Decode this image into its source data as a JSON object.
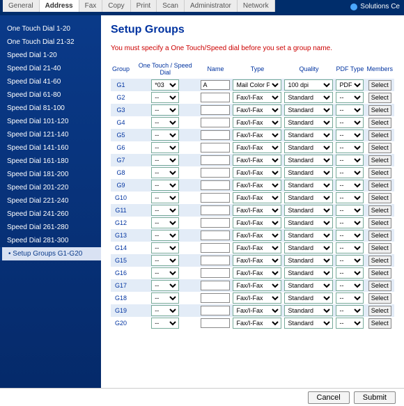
{
  "tabs": [
    "General",
    "Address",
    "Fax",
    "Copy",
    "Print",
    "Scan",
    "Administrator",
    "Network"
  ],
  "active_tab": 1,
  "brand": "Solutions Ce",
  "sidebar": {
    "items": [
      "One Touch Dial 1-20",
      "One Touch Dial 21-32",
      "Speed Dial 1-20",
      "Speed Dial 21-40",
      "Speed Dial 41-60",
      "Speed Dial 61-80",
      "Speed Dial 81-100",
      "Speed Dial 101-120",
      "Speed Dial 121-140",
      "Speed Dial 141-160",
      "Speed Dial 161-180",
      "Speed Dial 181-200",
      "Speed Dial 201-220",
      "Speed Dial 221-240",
      "Speed Dial 241-260",
      "Speed Dial 261-280",
      "Speed Dial 281-300",
      "Setup Groups G1-G20"
    ],
    "active_index": 17
  },
  "page": {
    "title": "Setup Groups",
    "note": "You must specify a One Touch/Speed dial before you set a group name.",
    "headers": {
      "group": "Group",
      "dial": "One Touch / Speed Dial",
      "name": "Name",
      "type": "Type",
      "quality": "Quality",
      "pdftype": "PDF Type",
      "members": "Members"
    },
    "select_label": "Select",
    "type_default": "Fax/I-Fax",
    "quality_default": "Standard",
    "pdf_default": "--",
    "rows": [
      {
        "g": "G1",
        "dial": "*03",
        "name": "A",
        "type": "Mail Color PDF",
        "quality": "100 dpi",
        "pdf": "PDF"
      },
      {
        "g": "G2",
        "dial": "--",
        "name": "",
        "type": "Fax/I-Fax",
        "quality": "Standard",
        "pdf": "--"
      },
      {
        "g": "G3",
        "dial": "--",
        "name": "",
        "type": "Fax/I-Fax",
        "quality": "Standard",
        "pdf": "--"
      },
      {
        "g": "G4",
        "dial": "--",
        "name": "",
        "type": "Fax/I-Fax",
        "quality": "Standard",
        "pdf": "--"
      },
      {
        "g": "G5",
        "dial": "--",
        "name": "",
        "type": "Fax/I-Fax",
        "quality": "Standard",
        "pdf": "--"
      },
      {
        "g": "G6",
        "dial": "--",
        "name": "",
        "type": "Fax/I-Fax",
        "quality": "Standard",
        "pdf": "--"
      },
      {
        "g": "G7",
        "dial": "--",
        "name": "",
        "type": "Fax/I-Fax",
        "quality": "Standard",
        "pdf": "--"
      },
      {
        "g": "G8",
        "dial": "--",
        "name": "",
        "type": "Fax/I-Fax",
        "quality": "Standard",
        "pdf": "--"
      },
      {
        "g": "G9",
        "dial": "--",
        "name": "",
        "type": "Fax/I-Fax",
        "quality": "Standard",
        "pdf": "--"
      },
      {
        "g": "G10",
        "dial": "--",
        "name": "",
        "type": "Fax/I-Fax",
        "quality": "Standard",
        "pdf": "--"
      },
      {
        "g": "G11",
        "dial": "--",
        "name": "",
        "type": "Fax/I-Fax",
        "quality": "Standard",
        "pdf": "--"
      },
      {
        "g": "G12",
        "dial": "--",
        "name": "",
        "type": "Fax/I-Fax",
        "quality": "Standard",
        "pdf": "--"
      },
      {
        "g": "G13",
        "dial": "--",
        "name": "",
        "type": "Fax/I-Fax",
        "quality": "Standard",
        "pdf": "--"
      },
      {
        "g": "G14",
        "dial": "--",
        "name": "",
        "type": "Fax/I-Fax",
        "quality": "Standard",
        "pdf": "--"
      },
      {
        "g": "G15",
        "dial": "--",
        "name": "",
        "type": "Fax/I-Fax",
        "quality": "Standard",
        "pdf": "--"
      },
      {
        "g": "G16",
        "dial": "--",
        "name": "",
        "type": "Fax/I-Fax",
        "quality": "Standard",
        "pdf": "--"
      },
      {
        "g": "G17",
        "dial": "--",
        "name": "",
        "type": "Fax/I-Fax",
        "quality": "Standard",
        "pdf": "--"
      },
      {
        "g": "G18",
        "dial": "--",
        "name": "",
        "type": "Fax/I-Fax",
        "quality": "Standard",
        "pdf": "--"
      },
      {
        "g": "G19",
        "dial": "--",
        "name": "",
        "type": "Fax/I-Fax",
        "quality": "Standard",
        "pdf": "--"
      },
      {
        "g": "G20",
        "dial": "--",
        "name": "",
        "type": "Fax/I-Fax",
        "quality": "Standard",
        "pdf": "--"
      }
    ]
  },
  "footer": {
    "cancel": "Cancel",
    "submit": "Submit"
  }
}
